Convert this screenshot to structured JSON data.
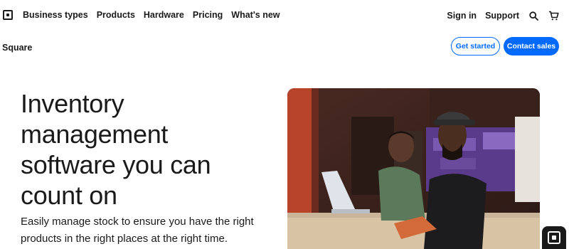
{
  "nav": {
    "links": [
      "Business types",
      "Products",
      "Hardware",
      "Pricing",
      "What's new"
    ],
    "sign_in": "Sign in",
    "support": "Support"
  },
  "subnav": {
    "brand": "Square",
    "get_started": "Get started",
    "contact_sales": "Contact sales"
  },
  "hero": {
    "headline_lines": [
      "Inventory",
      "management",
      "software you can",
      "count on"
    ],
    "subcopy_lines": [
      "Easily manage stock to ensure you have the right",
      "products in the right places at the right time."
    ]
  },
  "icons": {
    "logo": "square-logo-icon",
    "search": "search-icon",
    "cart": "cart-icon",
    "chat": "square-chat-icon"
  },
  "colors": {
    "accent": "#006aff",
    "text": "#1a1a1a"
  }
}
